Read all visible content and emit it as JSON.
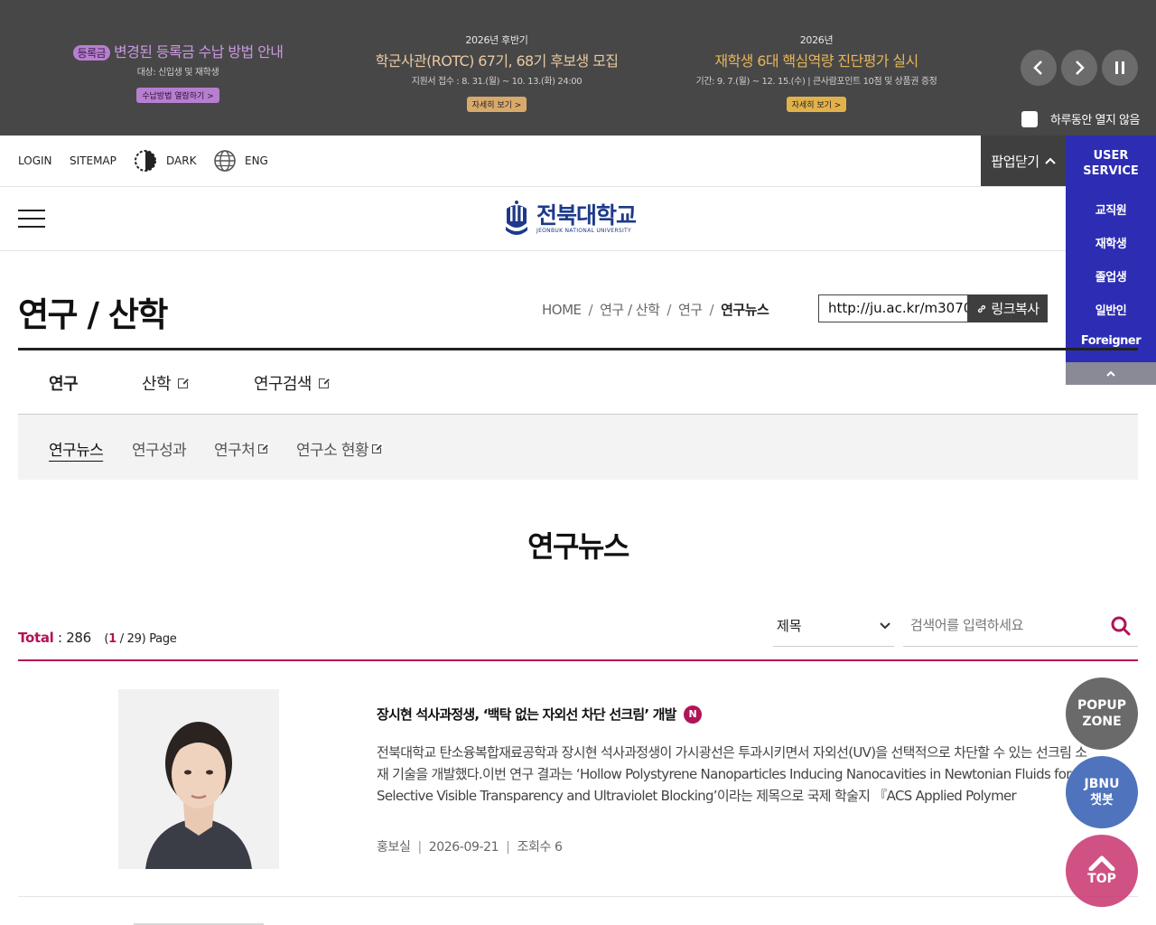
{
  "popup_banner": {
    "promos": [
      {
        "tag": "등록금",
        "headline": "변경된 등록금 수납 방법 안내",
        "sub": "대상: 신입생 및 재학생",
        "button": "수납방법 열람하기 >"
      },
      {
        "kicker": "2026년 후반기",
        "headline": "학군사관(ROTC) 67기, 68기 후보생 모집",
        "sub": "지원서 접수 : 8. 31.(월) ~ 10. 13.(화) 24:00",
        "button": "자세히 보기 >"
      },
      {
        "kicker": "2026년",
        "headline": "재학생 6대 핵심역량 진단평가 실시",
        "sub": "기간: 9. 7.(월) ~ 12. 15.(수) | 큰사람포인트 10점 및 상품권 증정",
        "button": "자세히 보기 >"
      }
    ],
    "controls": {
      "prev": "‹",
      "next": "›",
      "pause": "❚❚"
    },
    "no_show_today": "하루동안 열지 않음"
  },
  "utility": {
    "login": "LOGIN",
    "sitemap": "SITEMAP",
    "dark": "DARK",
    "eng": "ENG",
    "popup_close": "팝업닫기",
    "popup_close_icon": "chevron-up-icon"
  },
  "logo": {
    "name_ko": "전북대학교",
    "name_en": "JEONBUK NATIONAL UNIVERSITY"
  },
  "user_service": {
    "title_line1": "USER",
    "title_line2": "SERVICE",
    "items": [
      "교직원",
      "재학생",
      "졸업생",
      "일반인",
      "Foreigner"
    ],
    "fold": "^"
  },
  "page": {
    "title": "연구 / 산학",
    "breadcrumb": [
      "HOME",
      "연구 / 산학",
      "연구",
      "연구뉴스"
    ],
    "url": "http://ju.ac.kr/m3070",
    "copy_label": "링크복사"
  },
  "tabs_depth1": [
    {
      "label": "연구",
      "active": true,
      "external": false
    },
    {
      "label": "산학",
      "active": false,
      "external": true
    },
    {
      "label": "연구검색",
      "active": false,
      "external": true
    }
  ],
  "tabs_depth2": [
    {
      "label": "연구뉴스",
      "active": true,
      "external": false
    },
    {
      "label": "연구성과",
      "active": false,
      "external": false
    },
    {
      "label": "연구처",
      "active": false,
      "external": true
    },
    {
      "label": "연구소 현황",
      "active": false,
      "external": true
    }
  ],
  "content_title": "연구뉴스",
  "list_info": {
    "total_label": "Total",
    "total": "286",
    "current_page": "1",
    "total_pages": "/ 29) Page"
  },
  "search": {
    "field_selected": "제목",
    "placeholder": "검색어를 입력하세요"
  },
  "articles": [
    {
      "title": "장시현 석사과정생, ‘백탁 없는 자외선 차단 선크림’ 개발",
      "badge": "N",
      "summary": "전북대학교 탄소융복합재료공학과 장시현 석사과정생이 가시광선은 투과시키면서 자외선(UV)을 선택적으로 차단할 수 있는 선크림 소재 기술을 개발했다.이번 연구 결과는 ‘Hollow Polystyrene Nanoparticles Inducing Nanocavities in Newtonian Fluids for Selective Visible Transparency and Ultraviolet Blocking’이라는 제목으로 국제 학술지 『ACS Applied Polymer Materials』...",
      "writer": "홍보실",
      "date": "2026-09-21",
      "views": "조회수 6"
    }
  ],
  "floating": {
    "popup_line1": "POPUP",
    "popup_line2": "ZONE",
    "chat_line1": "JBNU",
    "chat_line2": "챗봇",
    "top": "TOP"
  },
  "colors": {
    "accent": "#b01457",
    "service_blue": "#2d2db3",
    "banner_bg": "#474747"
  }
}
